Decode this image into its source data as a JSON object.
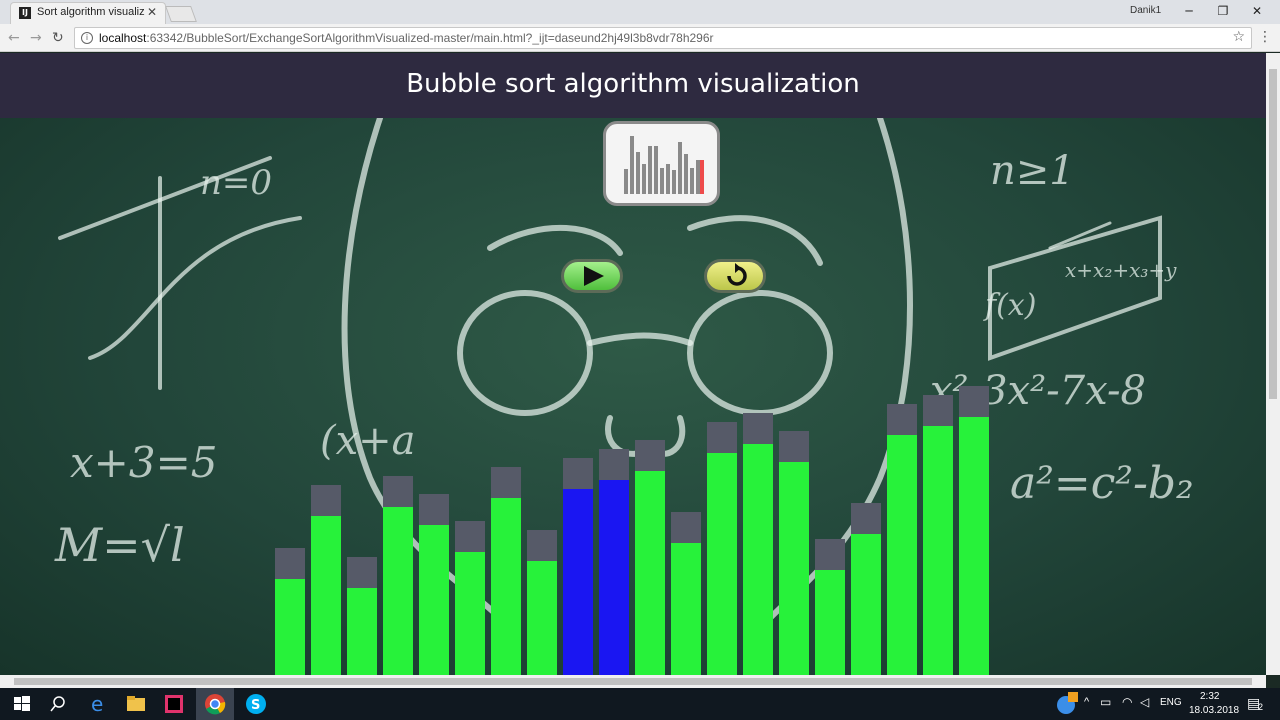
{
  "browser": {
    "tab_title": "Sort algorithm visualizat",
    "tab_favicon": "IJ",
    "user": "Danik1",
    "url_host": "localhost",
    "url_rest": ":63342/BubbleSort/ExchangeSortAlgorithmVisualized-master/main.html?_ijt=daseund2hj49l3b8vdr78h296r"
  },
  "page": {
    "title": "Bubble sort algorithm visualization",
    "play_icon": "play-icon",
    "reset_icon": "reset-icon",
    "logo_icon": "bar-chart-icon"
  },
  "chalk": [
    {
      "text": "n=0"
    },
    {
      "text": "n≥1"
    },
    {
      "text": "x+3=5"
    },
    {
      "text": "(x+a"
    },
    {
      "text": "x²-3x²-7x-8"
    },
    {
      "text": "a²=c²-b₂"
    },
    {
      "text": "M=√l"
    },
    {
      "text": "f(x)"
    },
    {
      "text": "x+x₂+x₃+y"
    }
  ],
  "colors": {
    "bar_green": "#27f23a",
    "bar_blue": "#1a16f2",
    "bar_cap": "#565a68",
    "header_bg": "#2e2a40"
  },
  "chart_data": {
    "type": "bar",
    "values": [
      120,
      183,
      111,
      192,
      174,
      147,
      201,
      138,
      210,
      219,
      228,
      156,
      246,
      255,
      237,
      129,
      165,
      264,
      273,
      282
    ],
    "highlighted": [
      8,
      9
    ],
    "ylim": [
      0,
      300
    ]
  },
  "taskbar": {
    "time": "2:32",
    "date": "18.03.2018",
    "lang": "ENG",
    "notification_count": "2"
  }
}
